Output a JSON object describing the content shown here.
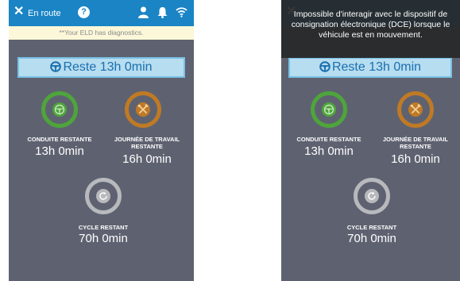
{
  "header": {
    "close_glyph": "✕",
    "status": "En route",
    "help_glyph": "?"
  },
  "banner": "**Your ELD has diagnostics.",
  "remaining_button": {
    "label": "Reste 13h 0min"
  },
  "gauges": {
    "driving": {
      "label": "CONDUITE RESTANTE",
      "value": "13h 0min",
      "color": "#4ea53b"
    },
    "workday": {
      "label_line1": "JOURNÉE DE TRAVAIL",
      "label_line2": "RESTANTE",
      "value": "16h 0min",
      "color": "#c07a25"
    },
    "cycle": {
      "label": "CYCLE RESTANT",
      "value": "70h 0min",
      "color": "#b8b9bd"
    }
  },
  "tooltip": {
    "text": "Impossible d'interagir avec le dispositif de consignation électronique (DCE) lorsque le véhicule est en mouvement."
  },
  "colors": {
    "topbar": "#1a84c5",
    "background": "#5e6270",
    "banner": "#fcf7d8",
    "button_fill": "#b7ddf0",
    "button_text": "#1a6fae"
  },
  "icons": [
    "close-icon",
    "help-icon",
    "person-icon",
    "bell-icon",
    "wifi-icon",
    "steering-wheel-icon",
    "tools-icon",
    "refresh-icon"
  ]
}
